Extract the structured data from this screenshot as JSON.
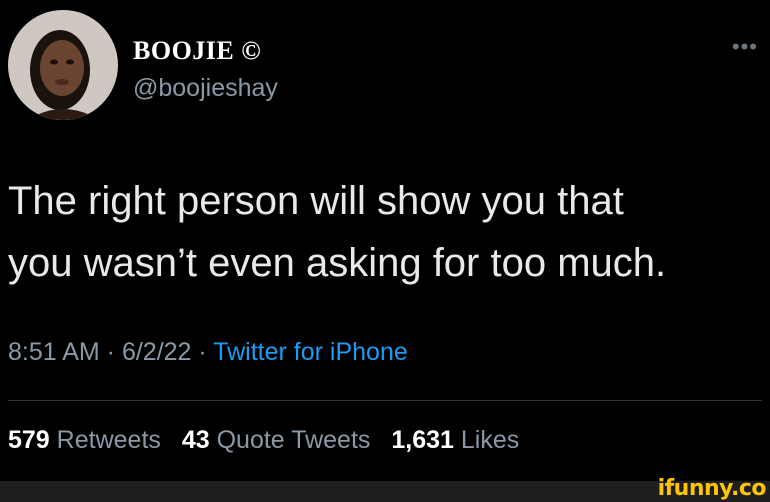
{
  "author": {
    "display_name": "BOOJIE ©",
    "handle": "@boojieshay",
    "avatar": "profile-photo"
  },
  "tweet": {
    "text_line1": "The right person will show you that",
    "text_line2": "you wasn’t even asking for too much."
  },
  "meta": {
    "time": "8:51 AM",
    "separator": " · ",
    "date": "6/2/22",
    "source": "Twitter for iPhone"
  },
  "stats": {
    "retweets_count": "579",
    "retweets_label": "Retweets",
    "quotes_count": "43",
    "quotes_label": "Quote Tweets",
    "likes_count": "1,631",
    "likes_label": "Likes"
  },
  "watermark": "ifunny.co",
  "icons": {
    "more": "more-horizontal-icon"
  },
  "colors": {
    "background": "#000000",
    "text": "#e7e9ea",
    "muted": "#8b98a5",
    "link": "#1d9bf0",
    "watermark": "#ffc600"
  }
}
